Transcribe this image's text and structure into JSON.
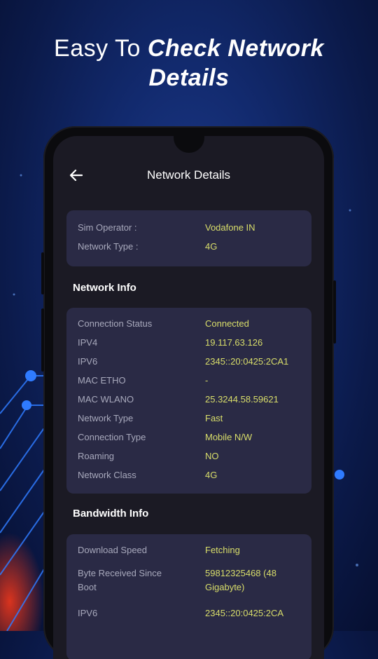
{
  "headline": {
    "light": "Easy To",
    "bold_line1": "Check Network",
    "bold_line2": "Details"
  },
  "header": {
    "back_icon": "arrow-left-icon",
    "title": "Network Details"
  },
  "sim_card": [
    {
      "label": "Sim Operator :",
      "value": "Vodafone IN"
    },
    {
      "label": "Network Type :",
      "value": "4G"
    }
  ],
  "network_info": {
    "title": "Network Info",
    "rows": [
      {
        "label": "Connection Status",
        "value": "Connected"
      },
      {
        "label": "IPV4",
        "value": "19.117.63.126"
      },
      {
        "label": "IPV6",
        "value": "2345::20:0425:2CA1"
      },
      {
        "label": "MAC ETHO",
        "value": "-"
      },
      {
        "label": "MAC WLANO",
        "value": "25.3244.58.59621"
      },
      {
        "label": "Network Type",
        "value": "Fast"
      },
      {
        "label": "Connection Type",
        "value": "Mobile N/W"
      },
      {
        "label": "Roaming",
        "value": "NO"
      },
      {
        "label": "Network Class",
        "value": "4G"
      }
    ]
  },
  "bandwidth_info": {
    "title": "Bandwidth Info",
    "rows": [
      {
        "label": "Download Speed",
        "value": "Fetching"
      },
      {
        "label": "Byte Received Since Boot",
        "value": "59812325468 (48 Gigabyte)"
      },
      {
        "label": "IPV6",
        "value": "2345::20:0425:2CA"
      }
    ]
  },
  "colors": {
    "accent_value": "#d9de6a",
    "card": "#2a2a45",
    "screen": "#1b1a24",
    "background": "#122a6e"
  }
}
